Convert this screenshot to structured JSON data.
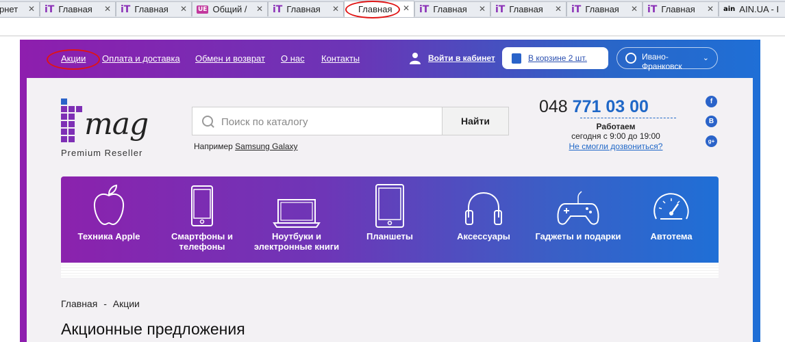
{
  "tabs": [
    {
      "label": "рнет",
      "icon": "none"
    },
    {
      "label": "Главная",
      "icon": "it-icon"
    },
    {
      "label": "Главная",
      "icon": "it-icon"
    },
    {
      "label": "Общий /",
      "icon": "ue-icon"
    },
    {
      "label": "Главная",
      "icon": "it-icon"
    },
    {
      "label": "Главная",
      "icon": "none"
    },
    {
      "label": "Главная",
      "icon": "it-icon"
    },
    {
      "label": "Главная",
      "icon": "it-icon"
    },
    {
      "label": "Главная",
      "icon": "it-icon"
    },
    {
      "label": "Главная",
      "icon": "it-icon"
    },
    {
      "label": "AIN.UA - I",
      "icon": "ain-icon"
    }
  ],
  "topnav": {
    "links": [
      "Акции",
      "Оплата и доставка",
      "Обмен и возврат",
      "О нас",
      "Контакты"
    ],
    "login": "Войти в кабинет",
    "cart": "В корзине 2 шт.",
    "city": "Ивано-Франковск"
  },
  "logo": {
    "mark": "mag",
    "tagline": "Premium Reseller"
  },
  "search": {
    "placeholder": "Поиск по каталогу",
    "button": "Найти",
    "example_prefix": "Например",
    "example_link": "Samsung Galaxy"
  },
  "contact": {
    "phone_code": "048",
    "phone_number": "771 03 00",
    "hours_title": "Работаем",
    "hours": "сегодня с 9:00 до 19:00",
    "callback": "Не смогли дозвониться?"
  },
  "social": [
    "f",
    "B",
    "g+"
  ],
  "categories": [
    {
      "label": "Техника Apple",
      "icon": "apple-icon"
    },
    {
      "label": "Смартфоны и телефоны",
      "icon": "smartphone-icon"
    },
    {
      "label": "Ноутбуки и электронные книги",
      "icon": "laptop-icon"
    },
    {
      "label": "Планшеты",
      "icon": "tablet-icon"
    },
    {
      "label": "Аксессуары",
      "icon": "headphones-icon"
    },
    {
      "label": "Гаджеты и подарки",
      "icon": "gamepad-icon"
    },
    {
      "label": "Автотема",
      "icon": "speedometer-icon"
    }
  ],
  "breadcrumb": {
    "home": "Главная",
    "separator": "-",
    "current": "Акции"
  },
  "page_title": "Акционные предложения",
  "colors": {
    "accent_blue": "#1f67c7",
    "brand_purple": "#8e1eae",
    "annotation_red": "#e01414"
  }
}
